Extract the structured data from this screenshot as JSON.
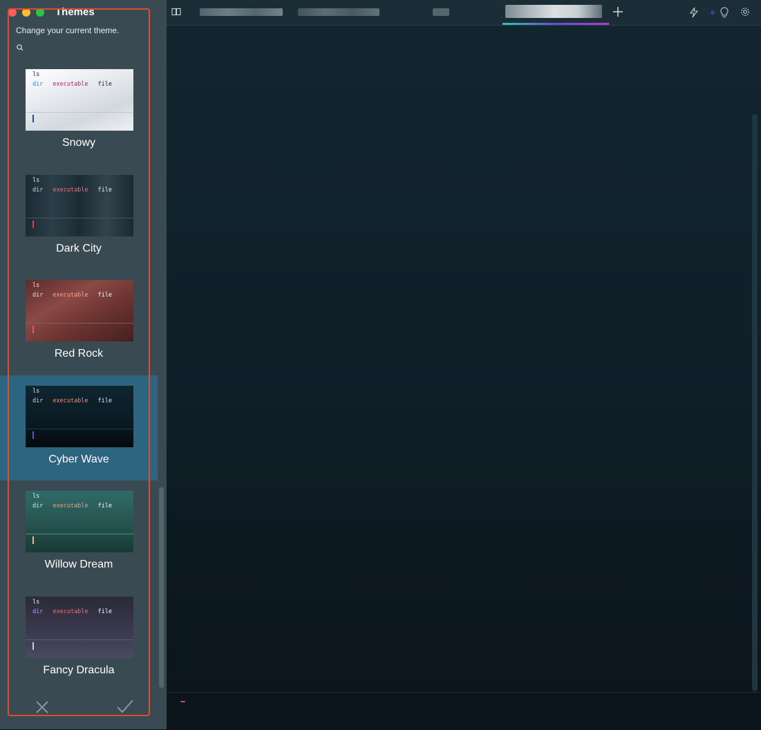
{
  "panel": {
    "title": "Themes",
    "subtitle": "Change your current theme.",
    "traffic_colors": [
      "#ff5f57",
      "#febc2e",
      "#28c840"
    ],
    "themes": [
      {
        "name": "Snowy",
        "selected": false,
        "ls": "ls",
        "dir": "dir",
        "exec": "executable",
        "file": "file",
        "bg": "linear-gradient(160deg,#ffffff 0%,#e6eaee 40%,#d2d8de 70%,#eef1f3 100%)",
        "ls_color": "#222222",
        "dir_color": "#2f86c8",
        "exec_color": "#b2226e",
        "file_color": "#222222",
        "divider": "#bfc6cc",
        "cursor": "#1f4f8a"
      },
      {
        "name": "Dark City",
        "selected": false,
        "ls": "ls",
        "dir": "dir",
        "exec": "executable",
        "file": "file",
        "bg": "linear-gradient(90deg,#1a2a33 0%,#2b3f49 25%,#1c2c35 50%,#31434c 75%,#1b2a32 100%)",
        "ls_color": "#e8eef1",
        "dir_color": "#c9d4d9",
        "exec_color": "#f0707a",
        "file_color": "#e8eef1",
        "divider": "#46555c",
        "cursor": "#e8364d"
      },
      {
        "name": "Red Rock",
        "selected": false,
        "ls": "ls",
        "dir": "dir",
        "exec": "executable",
        "file": "file",
        "bg": "linear-gradient(150deg,#5d2b2b 0%,#8a4a45 35%,#6e3532 60%,#45201f 100%)",
        "ls_color": "#f2e6e2",
        "dir_color": "#f2d7cf",
        "exec_color": "#ffa38b",
        "file_color": "#ffffff",
        "divider": "#8c5b56",
        "cursor": "#e8556b"
      },
      {
        "name": "Cyber Wave",
        "selected": true,
        "ls": "ls",
        "dir": "dir",
        "exec": "executable",
        "file": "file",
        "bg": "linear-gradient(180deg,#0e2530 0%,#0a1a22 60%,#05090c 100%)",
        "ls_color": "#e8eef1",
        "dir_color": "#c9d4d9",
        "exec_color": "#ff8a73",
        "file_color": "#e8eef1",
        "divider": "#26343c",
        "cursor": "#6a4ccf"
      },
      {
        "name": "Willow Dream",
        "selected": false,
        "ls": "ls",
        "dir": "dir",
        "exec": "executable",
        "file": "file",
        "bg": "linear-gradient(180deg,#2f6a68 0%,#275652 50%,#183a33 100%)",
        "ls_color": "#e8f2f0",
        "dir_color": "#d6e6e3",
        "exec_color": "#ff9a84",
        "file_color": "#ffffff",
        "divider": "#5e8582",
        "cursor": "#f0b7a6"
      },
      {
        "name": "Fancy Dracula",
        "selected": false,
        "ls": "ls",
        "dir": "dir",
        "exec": "executable",
        "file": "file",
        "bg": "linear-gradient(180deg,#2b2a3a 0%,#3a394d 55%,#4a4a60 100%)",
        "ls_color": "#f0f0f5",
        "dir_color": "#b69cff",
        "exec_color": "#ff6a6a",
        "file_color": "#ffffff",
        "divider": "#5d5c74",
        "cursor": "#c9c2ff"
      }
    ],
    "cancel_icon": "close-icon",
    "confirm_icon": "checkmark-icon"
  },
  "terminal": {
    "tabbar": {
      "book_icon": "book-icon",
      "new_tab_icon": "plus-icon",
      "right_icons": [
        "lightning-icon",
        "dot-icon",
        "lightbulb-icon",
        "gear-icon"
      ]
    },
    "prompt": "~",
    "prompt_color": "#ff6ad5"
  },
  "colors": {
    "panel_bg": "#3a4a52",
    "selected_bg": "#2d6580",
    "highlight_border": "#e24b2b",
    "terminal_bg": "#0f1c24"
  }
}
